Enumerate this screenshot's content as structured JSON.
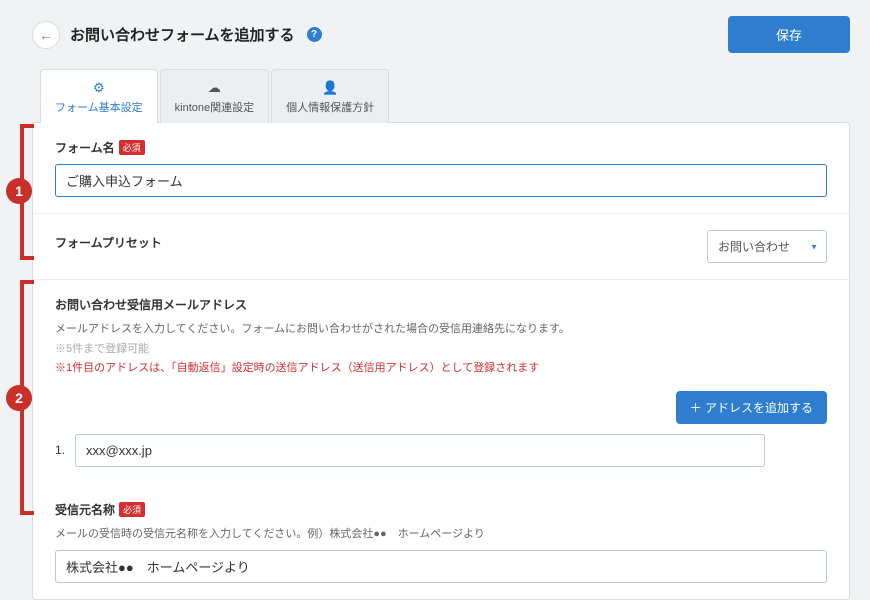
{
  "header": {
    "title": "お問い合わせフォームを追加する",
    "save_label": "保存"
  },
  "tabs": [
    {
      "label": "フォーム基本設定",
      "icon": "gear"
    },
    {
      "label": "kintone関連設定",
      "icon": "cloud"
    },
    {
      "label": "個人情報保護方針",
      "icon": "person"
    }
  ],
  "form_name": {
    "label": "フォーム名",
    "required": "必須",
    "value": "ご購入申込フォーム"
  },
  "preset": {
    "label": "フォームプリセット",
    "selected": "お問い合わせ"
  },
  "email": {
    "label": "お問い合わせ受信用メールアドレス",
    "help1": "メールアドレスを入力してください。フォームにお問い合わせがされた場合の受信用連絡先になります。",
    "help2": "※5件まで登録可能",
    "help3": "※1件目のアドレスは、「自動返信」設定時の送信アドレス（送信用アドレス）として登録されます",
    "add_btn": "＋ アドレスを追加する",
    "index1": "1.",
    "value1": "xxx@xxx.jp"
  },
  "sender": {
    "label": "受信元名称",
    "required": "必須",
    "help": "メールの受信時の受信元名称を入力してください。例）株式会社●●　ホームページより",
    "value": "株式会社●●　ホームページより"
  }
}
